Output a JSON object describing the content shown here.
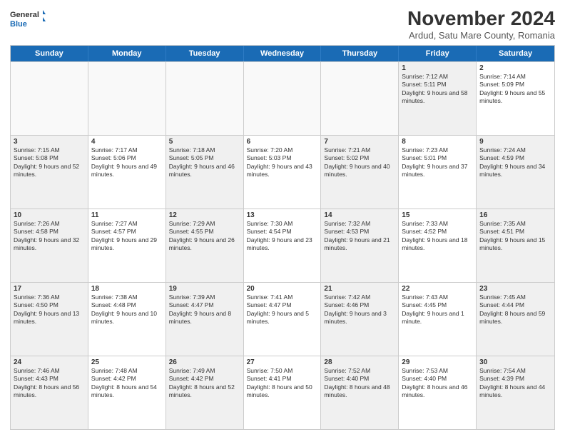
{
  "logo": {
    "line1": "General",
    "line2": "Blue"
  },
  "title": "November 2024",
  "subtitle": "Ardud, Satu Mare County, Romania",
  "days": [
    "Sunday",
    "Monday",
    "Tuesday",
    "Wednesday",
    "Thursday",
    "Friday",
    "Saturday"
  ],
  "rows": [
    [
      {
        "num": "",
        "text": "",
        "empty": true
      },
      {
        "num": "",
        "text": "",
        "empty": true
      },
      {
        "num": "",
        "text": "",
        "empty": true
      },
      {
        "num": "",
        "text": "",
        "empty": true
      },
      {
        "num": "",
        "text": "",
        "empty": true
      },
      {
        "num": "1",
        "text": "Sunrise: 7:12 AM\nSunset: 5:11 PM\nDaylight: 9 hours and 58 minutes.",
        "empty": false,
        "shaded": true
      },
      {
        "num": "2",
        "text": "Sunrise: 7:14 AM\nSunset: 5:09 PM\nDaylight: 9 hours and 55 minutes.",
        "empty": false,
        "shaded": false
      }
    ],
    [
      {
        "num": "3",
        "text": "Sunrise: 7:15 AM\nSunset: 5:08 PM\nDaylight: 9 hours and 52 minutes.",
        "empty": false,
        "shaded": true
      },
      {
        "num": "4",
        "text": "Sunrise: 7:17 AM\nSunset: 5:06 PM\nDaylight: 9 hours and 49 minutes.",
        "empty": false,
        "shaded": false
      },
      {
        "num": "5",
        "text": "Sunrise: 7:18 AM\nSunset: 5:05 PM\nDaylight: 9 hours and 46 minutes.",
        "empty": false,
        "shaded": true
      },
      {
        "num": "6",
        "text": "Sunrise: 7:20 AM\nSunset: 5:03 PM\nDaylight: 9 hours and 43 minutes.",
        "empty": false,
        "shaded": false
      },
      {
        "num": "7",
        "text": "Sunrise: 7:21 AM\nSunset: 5:02 PM\nDaylight: 9 hours and 40 minutes.",
        "empty": false,
        "shaded": true
      },
      {
        "num": "8",
        "text": "Sunrise: 7:23 AM\nSunset: 5:01 PM\nDaylight: 9 hours and 37 minutes.",
        "empty": false,
        "shaded": false
      },
      {
        "num": "9",
        "text": "Sunrise: 7:24 AM\nSunset: 4:59 PM\nDaylight: 9 hours and 34 minutes.",
        "empty": false,
        "shaded": true
      }
    ],
    [
      {
        "num": "10",
        "text": "Sunrise: 7:26 AM\nSunset: 4:58 PM\nDaylight: 9 hours and 32 minutes.",
        "empty": false,
        "shaded": true
      },
      {
        "num": "11",
        "text": "Sunrise: 7:27 AM\nSunset: 4:57 PM\nDaylight: 9 hours and 29 minutes.",
        "empty": false,
        "shaded": false
      },
      {
        "num": "12",
        "text": "Sunrise: 7:29 AM\nSunset: 4:55 PM\nDaylight: 9 hours and 26 minutes.",
        "empty": false,
        "shaded": true
      },
      {
        "num": "13",
        "text": "Sunrise: 7:30 AM\nSunset: 4:54 PM\nDaylight: 9 hours and 23 minutes.",
        "empty": false,
        "shaded": false
      },
      {
        "num": "14",
        "text": "Sunrise: 7:32 AM\nSunset: 4:53 PM\nDaylight: 9 hours and 21 minutes.",
        "empty": false,
        "shaded": true
      },
      {
        "num": "15",
        "text": "Sunrise: 7:33 AM\nSunset: 4:52 PM\nDaylight: 9 hours and 18 minutes.",
        "empty": false,
        "shaded": false
      },
      {
        "num": "16",
        "text": "Sunrise: 7:35 AM\nSunset: 4:51 PM\nDaylight: 9 hours and 15 minutes.",
        "empty": false,
        "shaded": true
      }
    ],
    [
      {
        "num": "17",
        "text": "Sunrise: 7:36 AM\nSunset: 4:50 PM\nDaylight: 9 hours and 13 minutes.",
        "empty": false,
        "shaded": true
      },
      {
        "num": "18",
        "text": "Sunrise: 7:38 AM\nSunset: 4:48 PM\nDaylight: 9 hours and 10 minutes.",
        "empty": false,
        "shaded": false
      },
      {
        "num": "19",
        "text": "Sunrise: 7:39 AM\nSunset: 4:47 PM\nDaylight: 9 hours and 8 minutes.",
        "empty": false,
        "shaded": true
      },
      {
        "num": "20",
        "text": "Sunrise: 7:41 AM\nSunset: 4:47 PM\nDaylight: 9 hours and 5 minutes.",
        "empty": false,
        "shaded": false
      },
      {
        "num": "21",
        "text": "Sunrise: 7:42 AM\nSunset: 4:46 PM\nDaylight: 9 hours and 3 minutes.",
        "empty": false,
        "shaded": true
      },
      {
        "num": "22",
        "text": "Sunrise: 7:43 AM\nSunset: 4:45 PM\nDaylight: 9 hours and 1 minute.",
        "empty": false,
        "shaded": false
      },
      {
        "num": "23",
        "text": "Sunrise: 7:45 AM\nSunset: 4:44 PM\nDaylight: 8 hours and 59 minutes.",
        "empty": false,
        "shaded": true
      }
    ],
    [
      {
        "num": "24",
        "text": "Sunrise: 7:46 AM\nSunset: 4:43 PM\nDaylight: 8 hours and 56 minutes.",
        "empty": false,
        "shaded": true
      },
      {
        "num": "25",
        "text": "Sunrise: 7:48 AM\nSunset: 4:42 PM\nDaylight: 8 hours and 54 minutes.",
        "empty": false,
        "shaded": false
      },
      {
        "num": "26",
        "text": "Sunrise: 7:49 AM\nSunset: 4:42 PM\nDaylight: 8 hours and 52 minutes.",
        "empty": false,
        "shaded": true
      },
      {
        "num": "27",
        "text": "Sunrise: 7:50 AM\nSunset: 4:41 PM\nDaylight: 8 hours and 50 minutes.",
        "empty": false,
        "shaded": false
      },
      {
        "num": "28",
        "text": "Sunrise: 7:52 AM\nSunset: 4:40 PM\nDaylight: 8 hours and 48 minutes.",
        "empty": false,
        "shaded": true
      },
      {
        "num": "29",
        "text": "Sunrise: 7:53 AM\nSunset: 4:40 PM\nDaylight: 8 hours and 46 minutes.",
        "empty": false,
        "shaded": false
      },
      {
        "num": "30",
        "text": "Sunrise: 7:54 AM\nSunset: 4:39 PM\nDaylight: 8 hours and 44 minutes.",
        "empty": false,
        "shaded": true
      }
    ]
  ]
}
